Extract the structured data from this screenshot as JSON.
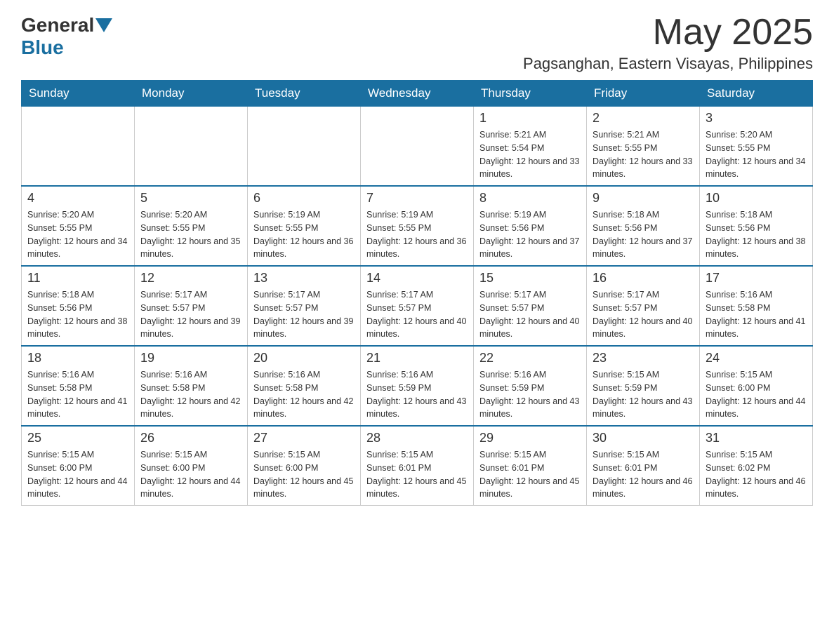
{
  "header": {
    "logo_general": "General",
    "logo_blue": "Blue",
    "month_title": "May 2025",
    "location": "Pagsanghan, Eastern Visayas, Philippines"
  },
  "days_of_week": [
    "Sunday",
    "Monday",
    "Tuesday",
    "Wednesday",
    "Thursday",
    "Friday",
    "Saturday"
  ],
  "weeks": [
    [
      {
        "day": "",
        "sunrise": "",
        "sunset": "",
        "daylight": ""
      },
      {
        "day": "",
        "sunrise": "",
        "sunset": "",
        "daylight": ""
      },
      {
        "day": "",
        "sunrise": "",
        "sunset": "",
        "daylight": ""
      },
      {
        "day": "",
        "sunrise": "",
        "sunset": "",
        "daylight": ""
      },
      {
        "day": "1",
        "sunrise": "Sunrise: 5:21 AM",
        "sunset": "Sunset: 5:54 PM",
        "daylight": "Daylight: 12 hours and 33 minutes."
      },
      {
        "day": "2",
        "sunrise": "Sunrise: 5:21 AM",
        "sunset": "Sunset: 5:55 PM",
        "daylight": "Daylight: 12 hours and 33 minutes."
      },
      {
        "day": "3",
        "sunrise": "Sunrise: 5:20 AM",
        "sunset": "Sunset: 5:55 PM",
        "daylight": "Daylight: 12 hours and 34 minutes."
      }
    ],
    [
      {
        "day": "4",
        "sunrise": "Sunrise: 5:20 AM",
        "sunset": "Sunset: 5:55 PM",
        "daylight": "Daylight: 12 hours and 34 minutes."
      },
      {
        "day": "5",
        "sunrise": "Sunrise: 5:20 AM",
        "sunset": "Sunset: 5:55 PM",
        "daylight": "Daylight: 12 hours and 35 minutes."
      },
      {
        "day": "6",
        "sunrise": "Sunrise: 5:19 AM",
        "sunset": "Sunset: 5:55 PM",
        "daylight": "Daylight: 12 hours and 36 minutes."
      },
      {
        "day": "7",
        "sunrise": "Sunrise: 5:19 AM",
        "sunset": "Sunset: 5:55 PM",
        "daylight": "Daylight: 12 hours and 36 minutes."
      },
      {
        "day": "8",
        "sunrise": "Sunrise: 5:19 AM",
        "sunset": "Sunset: 5:56 PM",
        "daylight": "Daylight: 12 hours and 37 minutes."
      },
      {
        "day": "9",
        "sunrise": "Sunrise: 5:18 AM",
        "sunset": "Sunset: 5:56 PM",
        "daylight": "Daylight: 12 hours and 37 minutes."
      },
      {
        "day": "10",
        "sunrise": "Sunrise: 5:18 AM",
        "sunset": "Sunset: 5:56 PM",
        "daylight": "Daylight: 12 hours and 38 minutes."
      }
    ],
    [
      {
        "day": "11",
        "sunrise": "Sunrise: 5:18 AM",
        "sunset": "Sunset: 5:56 PM",
        "daylight": "Daylight: 12 hours and 38 minutes."
      },
      {
        "day": "12",
        "sunrise": "Sunrise: 5:17 AM",
        "sunset": "Sunset: 5:57 PM",
        "daylight": "Daylight: 12 hours and 39 minutes."
      },
      {
        "day": "13",
        "sunrise": "Sunrise: 5:17 AM",
        "sunset": "Sunset: 5:57 PM",
        "daylight": "Daylight: 12 hours and 39 minutes."
      },
      {
        "day": "14",
        "sunrise": "Sunrise: 5:17 AM",
        "sunset": "Sunset: 5:57 PM",
        "daylight": "Daylight: 12 hours and 40 minutes."
      },
      {
        "day": "15",
        "sunrise": "Sunrise: 5:17 AM",
        "sunset": "Sunset: 5:57 PM",
        "daylight": "Daylight: 12 hours and 40 minutes."
      },
      {
        "day": "16",
        "sunrise": "Sunrise: 5:17 AM",
        "sunset": "Sunset: 5:57 PM",
        "daylight": "Daylight: 12 hours and 40 minutes."
      },
      {
        "day": "17",
        "sunrise": "Sunrise: 5:16 AM",
        "sunset": "Sunset: 5:58 PM",
        "daylight": "Daylight: 12 hours and 41 minutes."
      }
    ],
    [
      {
        "day": "18",
        "sunrise": "Sunrise: 5:16 AM",
        "sunset": "Sunset: 5:58 PM",
        "daylight": "Daylight: 12 hours and 41 minutes."
      },
      {
        "day": "19",
        "sunrise": "Sunrise: 5:16 AM",
        "sunset": "Sunset: 5:58 PM",
        "daylight": "Daylight: 12 hours and 42 minutes."
      },
      {
        "day": "20",
        "sunrise": "Sunrise: 5:16 AM",
        "sunset": "Sunset: 5:58 PM",
        "daylight": "Daylight: 12 hours and 42 minutes."
      },
      {
        "day": "21",
        "sunrise": "Sunrise: 5:16 AM",
        "sunset": "Sunset: 5:59 PM",
        "daylight": "Daylight: 12 hours and 43 minutes."
      },
      {
        "day": "22",
        "sunrise": "Sunrise: 5:16 AM",
        "sunset": "Sunset: 5:59 PM",
        "daylight": "Daylight: 12 hours and 43 minutes."
      },
      {
        "day": "23",
        "sunrise": "Sunrise: 5:15 AM",
        "sunset": "Sunset: 5:59 PM",
        "daylight": "Daylight: 12 hours and 43 minutes."
      },
      {
        "day": "24",
        "sunrise": "Sunrise: 5:15 AM",
        "sunset": "Sunset: 6:00 PM",
        "daylight": "Daylight: 12 hours and 44 minutes."
      }
    ],
    [
      {
        "day": "25",
        "sunrise": "Sunrise: 5:15 AM",
        "sunset": "Sunset: 6:00 PM",
        "daylight": "Daylight: 12 hours and 44 minutes."
      },
      {
        "day": "26",
        "sunrise": "Sunrise: 5:15 AM",
        "sunset": "Sunset: 6:00 PM",
        "daylight": "Daylight: 12 hours and 44 minutes."
      },
      {
        "day": "27",
        "sunrise": "Sunrise: 5:15 AM",
        "sunset": "Sunset: 6:00 PM",
        "daylight": "Daylight: 12 hours and 45 minutes."
      },
      {
        "day": "28",
        "sunrise": "Sunrise: 5:15 AM",
        "sunset": "Sunset: 6:01 PM",
        "daylight": "Daylight: 12 hours and 45 minutes."
      },
      {
        "day": "29",
        "sunrise": "Sunrise: 5:15 AM",
        "sunset": "Sunset: 6:01 PM",
        "daylight": "Daylight: 12 hours and 45 minutes."
      },
      {
        "day": "30",
        "sunrise": "Sunrise: 5:15 AM",
        "sunset": "Sunset: 6:01 PM",
        "daylight": "Daylight: 12 hours and 46 minutes."
      },
      {
        "day": "31",
        "sunrise": "Sunrise: 5:15 AM",
        "sunset": "Sunset: 6:02 PM",
        "daylight": "Daylight: 12 hours and 46 minutes."
      }
    ]
  ]
}
